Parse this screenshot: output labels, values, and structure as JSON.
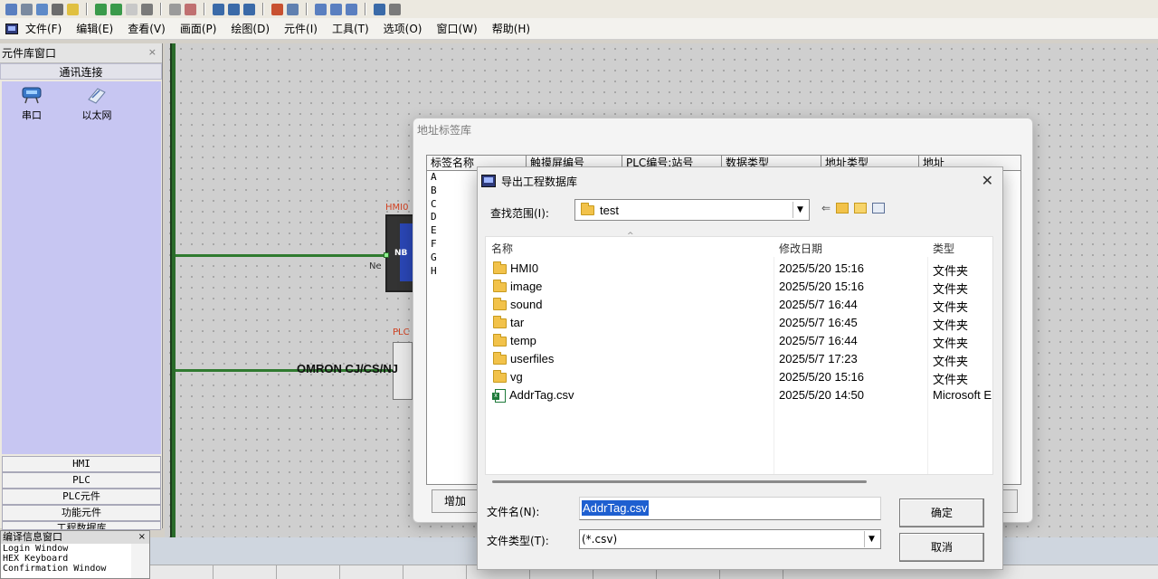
{
  "menubar": {
    "items": [
      "文件(F)",
      "编辑(E)",
      "查看(V)",
      "画面(P)",
      "绘图(D)",
      "元件(I)",
      "工具(T)",
      "选项(O)",
      "窗口(W)",
      "帮助(H)"
    ]
  },
  "library": {
    "title": "元件库窗口",
    "close": "×",
    "section": "通讯连接",
    "items": [
      {
        "label": "串口",
        "icon": "serial-port-icon"
      },
      {
        "label": "以太网",
        "icon": "ethernet-icon"
      }
    ],
    "tabs": [
      "HMI",
      "PLC",
      "PLC元件",
      "功能元件",
      "工程数据库"
    ]
  },
  "canvas": {
    "hmi_label": "HMI0",
    "hmi_model": "NB",
    "hmi_net": "Ne",
    "plc_label": "PLC",
    "plc_model": "OMRON CJ/CS/NJ"
  },
  "compile": {
    "title": "编译信息窗口",
    "close": "×",
    "lines": [
      "Login Window",
      "HEX Keyboard",
      "Confirmation Window"
    ]
  },
  "tag_dialog": {
    "title": "地址标签库",
    "columns": [
      "标签名称",
      "触摸屏编号",
      "PLC编号:站号",
      "数据类型",
      "地址类型",
      "地址"
    ],
    "rows": [
      "A",
      "B",
      "C",
      "D",
      "E",
      "F",
      "G",
      "H"
    ],
    "add_button": "增加"
  },
  "export_dialog": {
    "title": "导出工程数据库",
    "close": "✕",
    "lookin_label": "查找范围(I):",
    "lookin_value": "test",
    "columns": {
      "name": "名称",
      "date": "修改日期",
      "type": "类型"
    },
    "files": [
      {
        "name": "HMI0",
        "date": "2025/5/20 15:16",
        "type": "文件夹",
        "icon": "folder-icon"
      },
      {
        "name": "image",
        "date": "2025/5/20 15:16",
        "type": "文件夹",
        "icon": "folder-icon"
      },
      {
        "name": "sound",
        "date": "2025/5/7 16:44",
        "type": "文件夹",
        "icon": "folder-icon"
      },
      {
        "name": "tar",
        "date": "2025/5/7 16:45",
        "type": "文件夹",
        "icon": "folder-icon"
      },
      {
        "name": "temp",
        "date": "2025/5/7 16:44",
        "type": "文件夹",
        "icon": "folder-icon"
      },
      {
        "name": "userfiles",
        "date": "2025/5/7 17:23",
        "type": "文件夹",
        "icon": "folder-icon"
      },
      {
        "name": "vg",
        "date": "2025/5/20 15:16",
        "type": "文件夹",
        "icon": "folder-icon"
      },
      {
        "name": "AddrTag.csv",
        "date": "2025/5/20 14:50",
        "type": "Microsoft E",
        "icon": "csv-file-icon"
      }
    ],
    "filename_label": "文件名(N):",
    "filename_value": "AddrTag.csv",
    "filetype_label": "文件类型(T):",
    "filetype_value": "(*.csv)",
    "ok_button": "确定",
    "cancel_button": "取消"
  },
  "colors": {
    "library_bg": "#c7c6f2",
    "selection": "#1e5fd0",
    "connection_line": "#2f7a2f",
    "folder": "#f2c24a"
  }
}
